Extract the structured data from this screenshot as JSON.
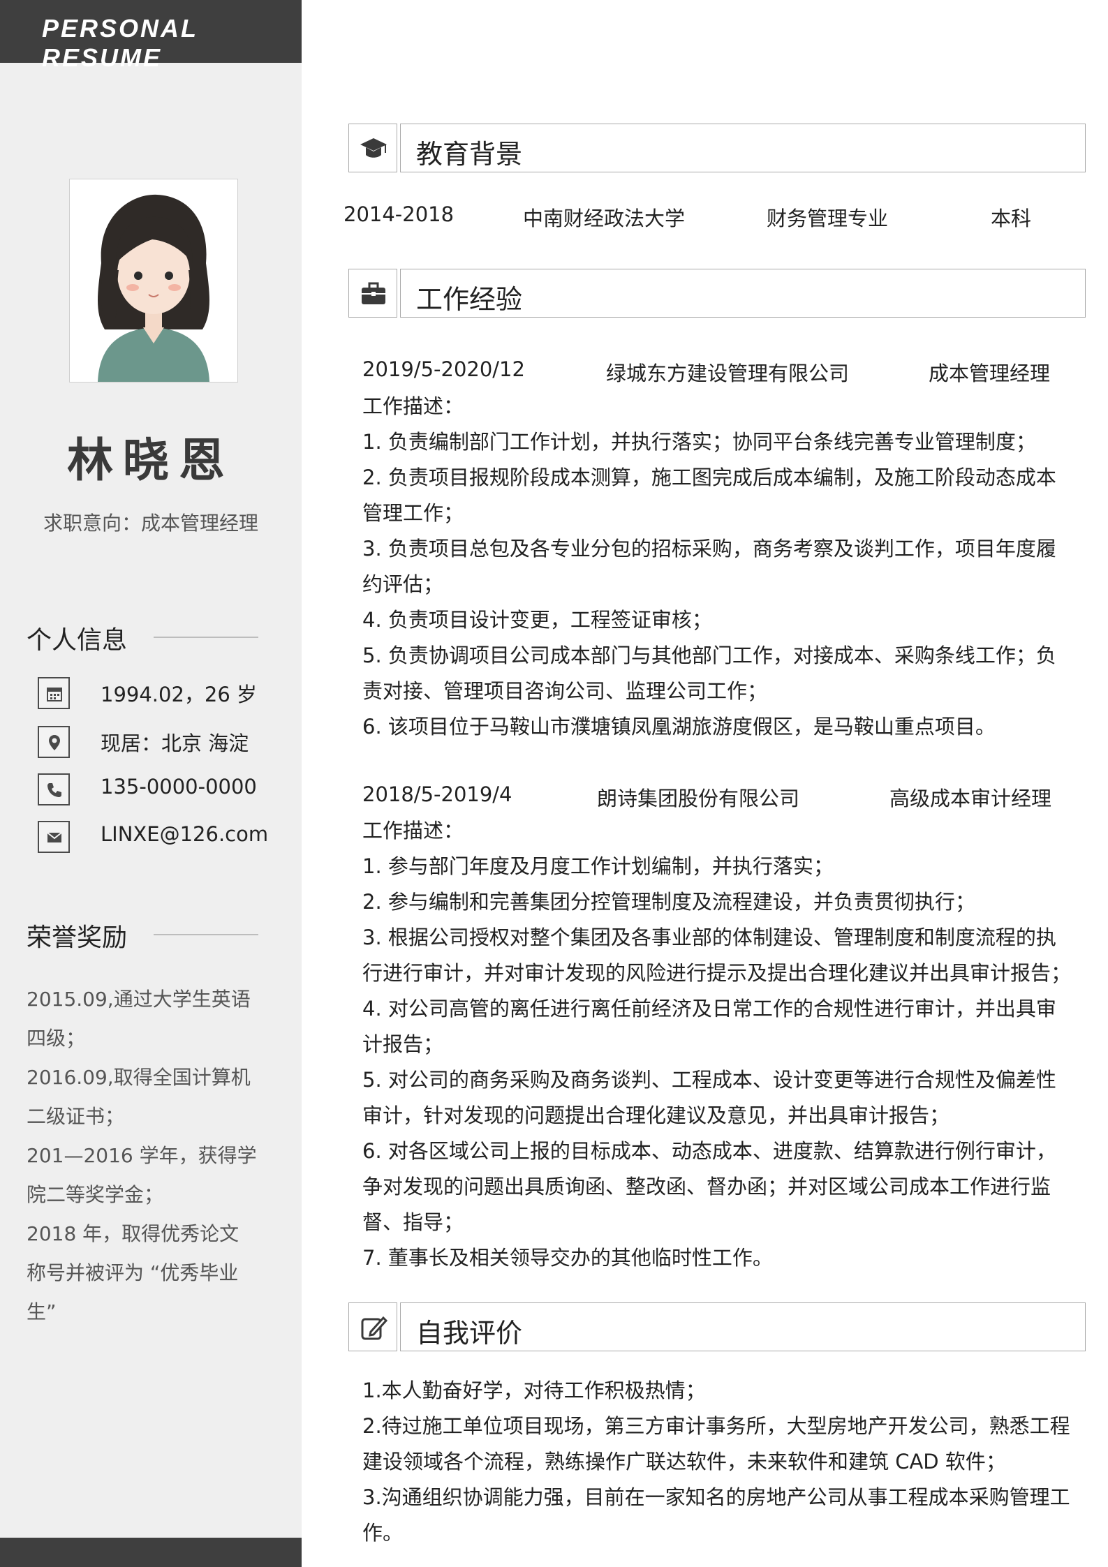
{
  "header": {
    "banner": "PERSONAL RESUME"
  },
  "profile": {
    "name": "林晓恩",
    "intent": "求职意向：成本管理经理"
  },
  "personal": {
    "heading": "个人信息",
    "birth": "1994.02，26 岁",
    "location": "现居：北京  海淀",
    "phone": "135-0000-0000",
    "email": "LINXE@126.com"
  },
  "honors": {
    "heading": "荣誉奖励",
    "items": [
      "2015.09,通过大学生英语四级；",
      "2016.09,取得全国计算机二级证书；",
      "201—2016 学年，获得学院二等奖学金；",
      "2018 年，取得优秀论文称号并被评为 “优秀毕业生”"
    ]
  },
  "education": {
    "title": "教育背景",
    "period": "2014-2018",
    "school": "中南财经政法大学",
    "major": "财务管理专业",
    "degree": "本科"
  },
  "work": {
    "title": "工作经验",
    "jobs": [
      {
        "period": "2019/5-2020/12",
        "company": "绿城东方建设管理有限公司",
        "position": "成本管理经理",
        "desc_label": "工作描述：",
        "items": [
          "1. 负责编制部门工作计划，并执行落实；协同平台条线完善专业管理制度；",
          "2. 负责项目报规阶段成本测算，施工图完成后成本编制，及施工阶段动态成本管理工作；",
          "3. 负责项目总包及各专业分包的招标采购，商务考察及谈判工作，项目年度履约评估；",
          "4. 负责项目设计变更，工程签证审核；",
          "5. 负责协调项目公司成本部门与其他部门工作，对接成本、采购条线工作；负责对接、管理项目咨询公司、监理公司工作；",
          "6. 该项目位于马鞍山市濮塘镇凤凰湖旅游度假区，是马鞍山重点项目。"
        ]
      },
      {
        "period": "2018/5-2019/4",
        "company": "朗诗集团股份有限公司",
        "position": "高级成本审计经理",
        "desc_label": "工作描述：",
        "items": [
          "1. 参与部门年度及月度工作计划编制，并执行落实；",
          "2. 参与编制和完善集团分控管理制度及流程建设，并负责贯彻执行；",
          "3. 根据公司授权对整个集团及各事业部的体制建设、管理制度和制度流程的执行进行审计，并对审计发现的风险进行提示及提出合理化建议并出具审计报告；",
          "4. 对公司高管的离任进行离任前经济及日常工作的合规性进行审计，并出具审计报告；",
          "5. 对公司的商务采购及商务谈判、工程成本、设计变更等进行合规性及偏差性审计，针对发现的问题提出合理化建议及意见，并出具审计报告；",
          "6. 对各区域公司上报的目标成本、动态成本、进度款、结算款进行例行审计，争对发现的问题出具质询函、整改函、督办函；并对区域公司成本工作进行监督、指导；",
          "7. 董事长及相关领导交办的其他临时性工作。"
        ]
      }
    ]
  },
  "self_eval": {
    "title": "自我评价",
    "items": [
      "1.本人勤奋好学，对待工作积极热情；",
      "2.待过施工单位项目现场，第三方审计事务所，大型房地产开发公司，熟悉工程建设领域各个流程，熟练操作广联达软件，未来软件和建筑 CAD 软件；",
      "3.沟通组织协调能力强，目前在一家知名的房地产公司从事工程成本采购管理工作。"
    ]
  },
  "icons": {
    "section_education": "graduation-cap-icon",
    "section_work": "briefcase-icon",
    "section_self": "edit-icon",
    "birth": "calendar-icon",
    "location": "location-pin-icon",
    "phone": "phone-icon",
    "email": "mail-icon"
  },
  "colors": {
    "dark": "#3f3f3f",
    "sidebar": "#efefef"
  }
}
